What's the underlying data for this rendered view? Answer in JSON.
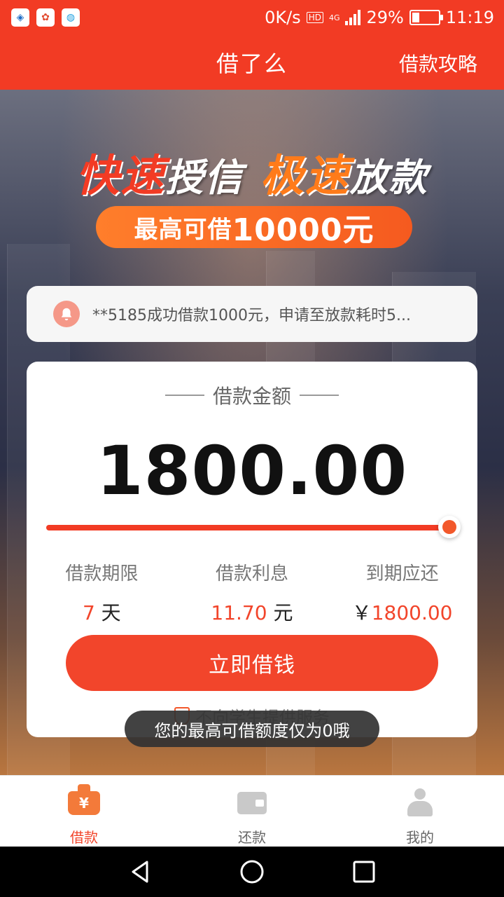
{
  "status_bar": {
    "net_speed": "0K/s",
    "network": "4G",
    "battery": "29%",
    "battery_level": 0.29,
    "time": "11:19"
  },
  "header": {
    "title": "借了么",
    "link": "借款攻略"
  },
  "banner": {
    "word1": "快速",
    "word2": "授信",
    "word3": "极速",
    "word4": "放款",
    "pill_prefix": "最高可借",
    "pill_amount": "10000元"
  },
  "notice": {
    "text": "**5185成功借款1000元，申请至放款耗时5..."
  },
  "loan": {
    "title": "借款金额",
    "amount": "1800.00",
    "slider_fraction": 1.0,
    "term_label": "借款期限",
    "term_value": "7",
    "term_unit": "天",
    "interest_label": "借款利息",
    "interest_value": "11.70",
    "interest_unit": "元",
    "due_label": "到期应还",
    "due_currency": "￥",
    "due_value": "1800.00",
    "cta_label": "立即借钱",
    "footnote": "不向学生提供服务"
  },
  "toast": {
    "text": "您的最高可借额度仅为0哦"
  },
  "bottom_nav": {
    "items": [
      {
        "label": "借款",
        "icon": "yen-bag-icon"
      },
      {
        "label": "还款",
        "icon": "wallet-icon"
      },
      {
        "label": "我的",
        "icon": "user-icon"
      }
    ]
  },
  "colors": {
    "brand": "#f23b24",
    "accent": "#f2452b"
  }
}
